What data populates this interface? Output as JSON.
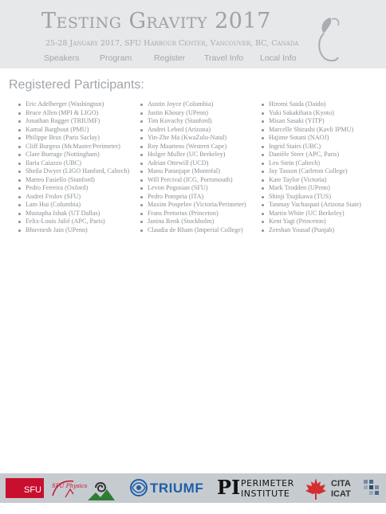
{
  "header": {
    "title": "Testing Gravity 2017",
    "subtitle": "25-28 January 2017, SFU Harbour Center, Vancouver, BC, Canada"
  },
  "nav": [
    {
      "label": "Speakers"
    },
    {
      "label": "Program"
    },
    {
      "label": "Register"
    },
    {
      "label": "Travel Info"
    },
    {
      "label": "Local Info"
    }
  ],
  "heading": "Registered Participants:",
  "participants": {
    "column1": [
      "Eric Adelberger (Washington)",
      "Bruce Allen (MPI & LIGO)",
      "Jonathan Bagger (TRIUMF)",
      "Kamal Barghout (PMU)",
      "Philippe Brax (Paris Saclay)",
      "Cliff Burgess (McMaster/Perimeter)",
      "Clare Burrage (Nottingham)",
      "Ilaria Caiazzo (UBC)",
      "Sheila Dwyer (LIGO Hanford, Caltech)",
      "Matteo Fasiello (Stanford)",
      "Pedro Ferreira (Oxford)",
      "Andrei Frolov (SFU)",
      "Lam Hui (Columbia)",
      "Mustapha Ishak (UT Dallas)",
      "Felix-Louis Julié (APC, Paris)",
      "Bhuvnesh Jain (UPenn)"
    ],
    "column2": [
      "Austin Joyce (Columbia)",
      "Justin Khoury (UPenn)",
      "Tim Kovachy (Stanford)",
      "Andrei Lebed (Arizona)",
      "Yin-Zhe Ma (KwaZulu-Natal)",
      "Roy Maartens (Western Cape)",
      "Holger Muller (UC Berkeley)",
      "Adrian Ottewill (UCD)",
      "Manu Paranjape (Montréal)",
      "Will Percival (ICG, Portsmouth)",
      "Levon Pogosian (SFU)",
      "Pedro Pompeia (ITA)",
      "Maxim Pospelov (Victoria/Perimeter)",
      "Frans Pretorius (Princeton)",
      "Janina Renk (Stockholm)",
      "Claudia de Rham (Imperial College)"
    ],
    "column3": [
      "Hiromi Saida (Daido)",
      "Yuki Sakakihara (Kyoto)",
      "Misao Sasaki (YITP)",
      "Marcelle Shirashi (Kavli IPMU)",
      "Hajime Sotani (NAOJ)",
      "Ingrid Stairs (UBC)",
      "Danièle Steer (APC, Paris)",
      "Leo Stein (Caltech)",
      "Jay Tasson (Carleton College)",
      "Kate Taylor (Victoria)",
      "Mark Trodden (UPenn)",
      "Shinji Tsujikawa (TUS)",
      "Tanmay Vachaspati (Arizona State)",
      "Martin White (UC Berkeley)",
      "Kent Yagi (Princeton)",
      "Zeeshan Yousaf (Punjab)"
    ]
  },
  "sponsors": {
    "sfu": "SFU",
    "sfu_physics": "SFU Physics",
    "triumf": "TRIUMF",
    "perimeter_line1": "PERIMETER",
    "perimeter_line2": "INSTITUTE",
    "cita_line1": "CITA",
    "cita_line2": "ICAT"
  },
  "colors": {
    "header_bg": "#e6e8ea",
    "header_text": "#9ea2a6",
    "footer_bg": "#c6cbd0",
    "sfu_red": "#c8102e",
    "triumf_blue": "#1f5fa8"
  }
}
